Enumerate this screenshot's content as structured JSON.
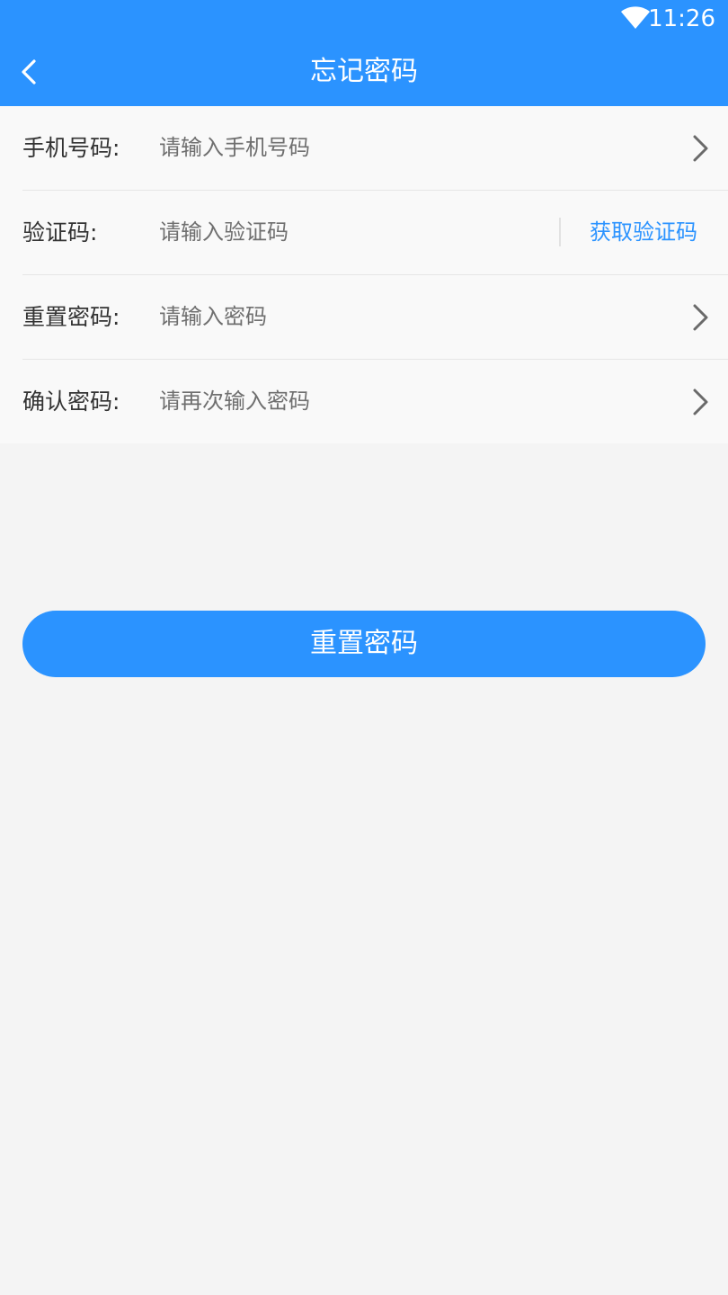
{
  "status_bar": {
    "time": "11:26",
    "wifi_icon": "wifi-icon"
  },
  "app_bar": {
    "title": "忘记密码",
    "back_icon": "back-arrow-icon"
  },
  "form": {
    "phone": {
      "label": "手机号码:",
      "placeholder": "请输入手机号码",
      "value": "",
      "icon": "chevron-right-icon"
    },
    "code": {
      "label": "验证码:",
      "placeholder": "请输入验证码",
      "value": "",
      "action_label": "获取验证码"
    },
    "new_password": {
      "label": "重置密码:",
      "placeholder": "请输入密码",
      "value": "",
      "icon": "chevron-right-icon"
    },
    "confirm_password": {
      "label": "确认密码:",
      "placeholder": "请再次输入密码",
      "value": "",
      "icon": "chevron-right-icon"
    }
  },
  "submit_button": {
    "label": "重置密码"
  },
  "colors": {
    "primary": "#2b93ff",
    "background": "#f4f4f4",
    "form_background": "#f9f9f9",
    "label_text": "#333333",
    "placeholder_text": "#6f6f6f",
    "chevron": "#6a6a6a"
  }
}
